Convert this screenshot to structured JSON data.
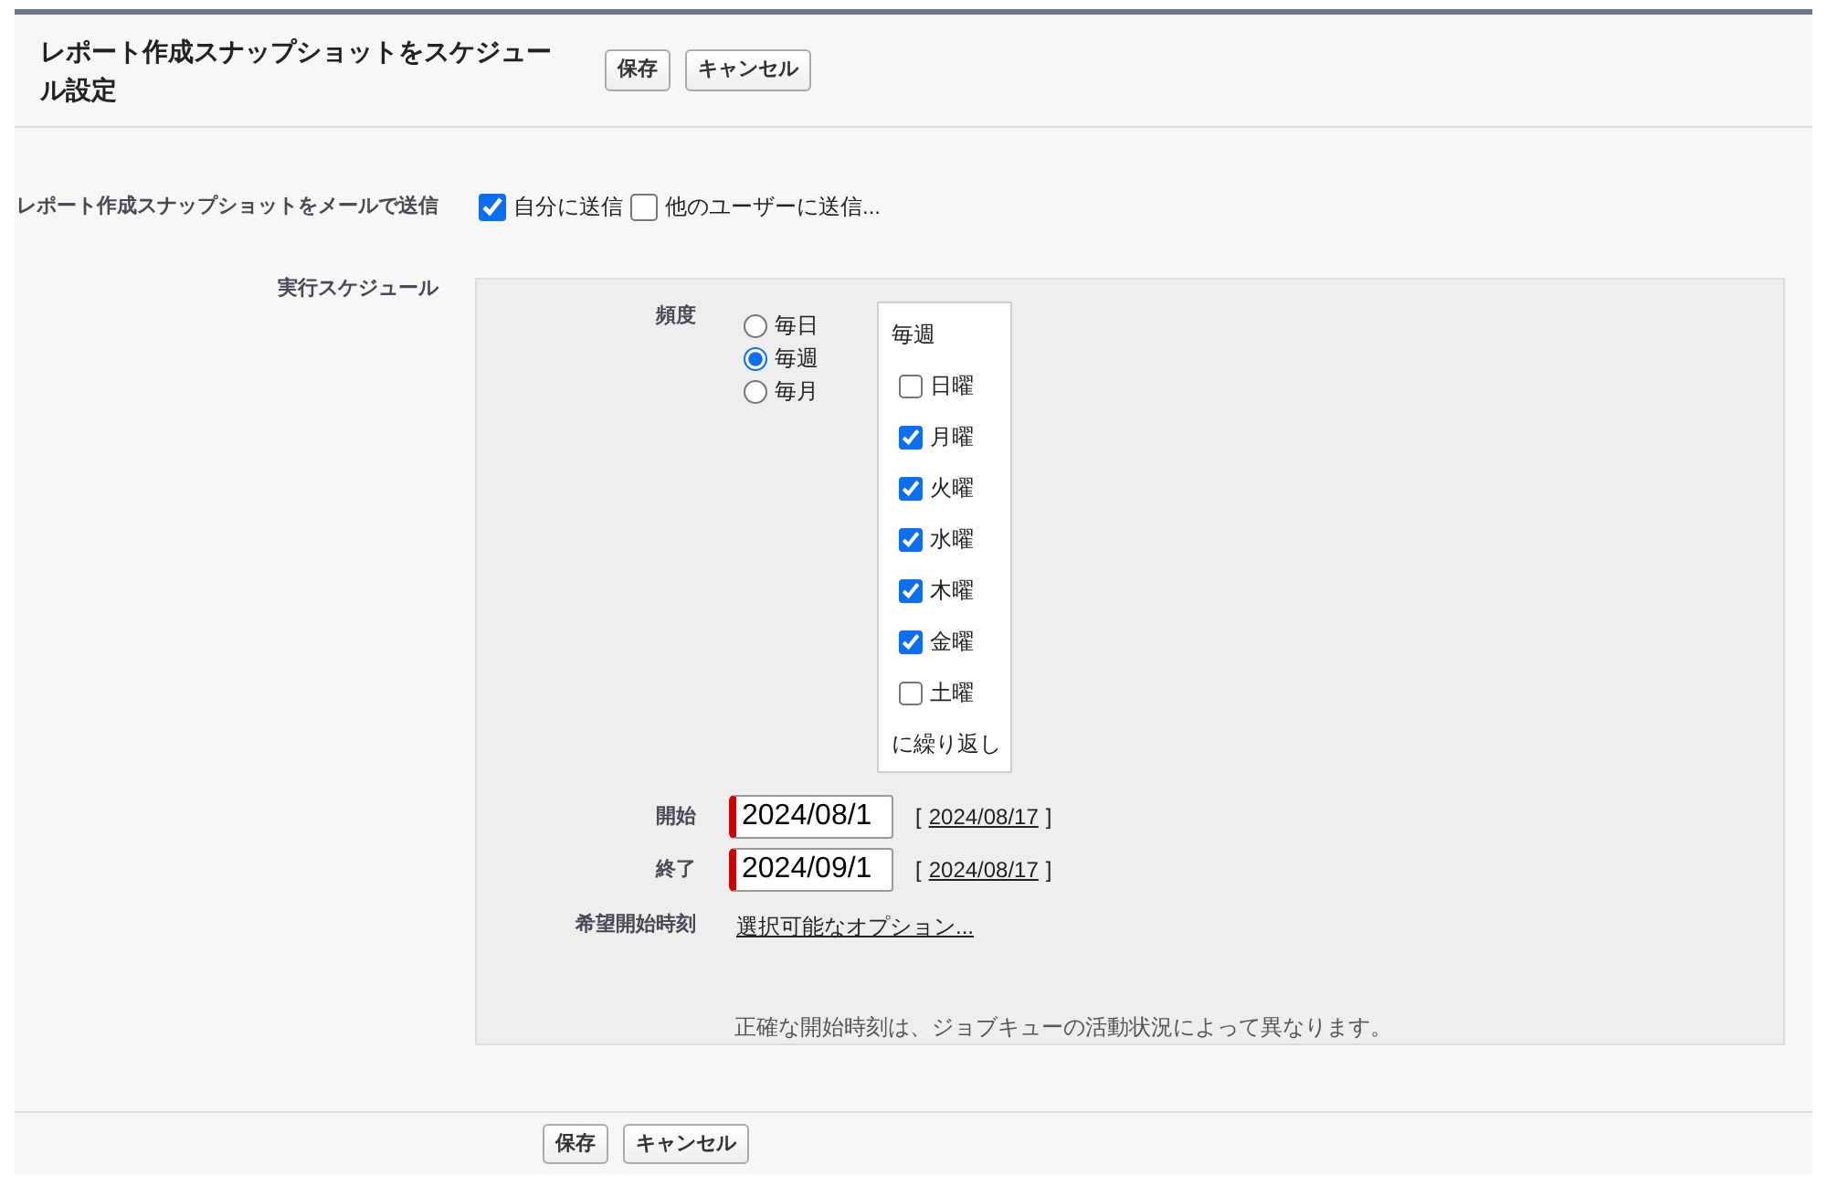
{
  "header": {
    "title": "レポート作成スナップショットをスケジュール設定",
    "buttons": [
      "保存",
      "キャンセル"
    ]
  },
  "email": {
    "label": "レポート作成スナップショットをメールで送信",
    "options": [
      {
        "label": "自分に送信",
        "checked": true
      },
      {
        "label": "他のユーザーに送信...",
        "checked": false
      }
    ]
  },
  "schedule": {
    "label": "実行スケジュール",
    "frequency": {
      "label": "頻度",
      "options": [
        {
          "label": "毎日",
          "selected": false
        },
        {
          "label": "毎週",
          "selected": true
        },
        {
          "label": "毎月",
          "selected": false
        }
      ]
    },
    "weekly": {
      "title": "毎週",
      "days": [
        {
          "label": "日曜",
          "checked": false
        },
        {
          "label": "月曜",
          "checked": true
        },
        {
          "label": "火曜",
          "checked": true
        },
        {
          "label": "水曜",
          "checked": true
        },
        {
          "label": "木曜",
          "checked": true
        },
        {
          "label": "金曜",
          "checked": true
        },
        {
          "label": "土曜",
          "checked": false
        }
      ],
      "footer": "に繰り返し"
    },
    "dates": [
      {
        "label": "開始",
        "value": "2024/08/1",
        "open": "[",
        "today": "2024/08/17",
        "close": "]"
      },
      {
        "label": "終了",
        "value": "2024/09/1",
        "open": "[",
        "today": "2024/08/17",
        "close": "]"
      }
    ],
    "preferred_time": {
      "label": "希望開始時刻",
      "link": "選択可能なオプション..."
    },
    "note": "正確な開始時刻は、ジョブキューの活動状況によって異なります。"
  },
  "footer": {
    "buttons": [
      "保存",
      "キャンセル"
    ]
  }
}
